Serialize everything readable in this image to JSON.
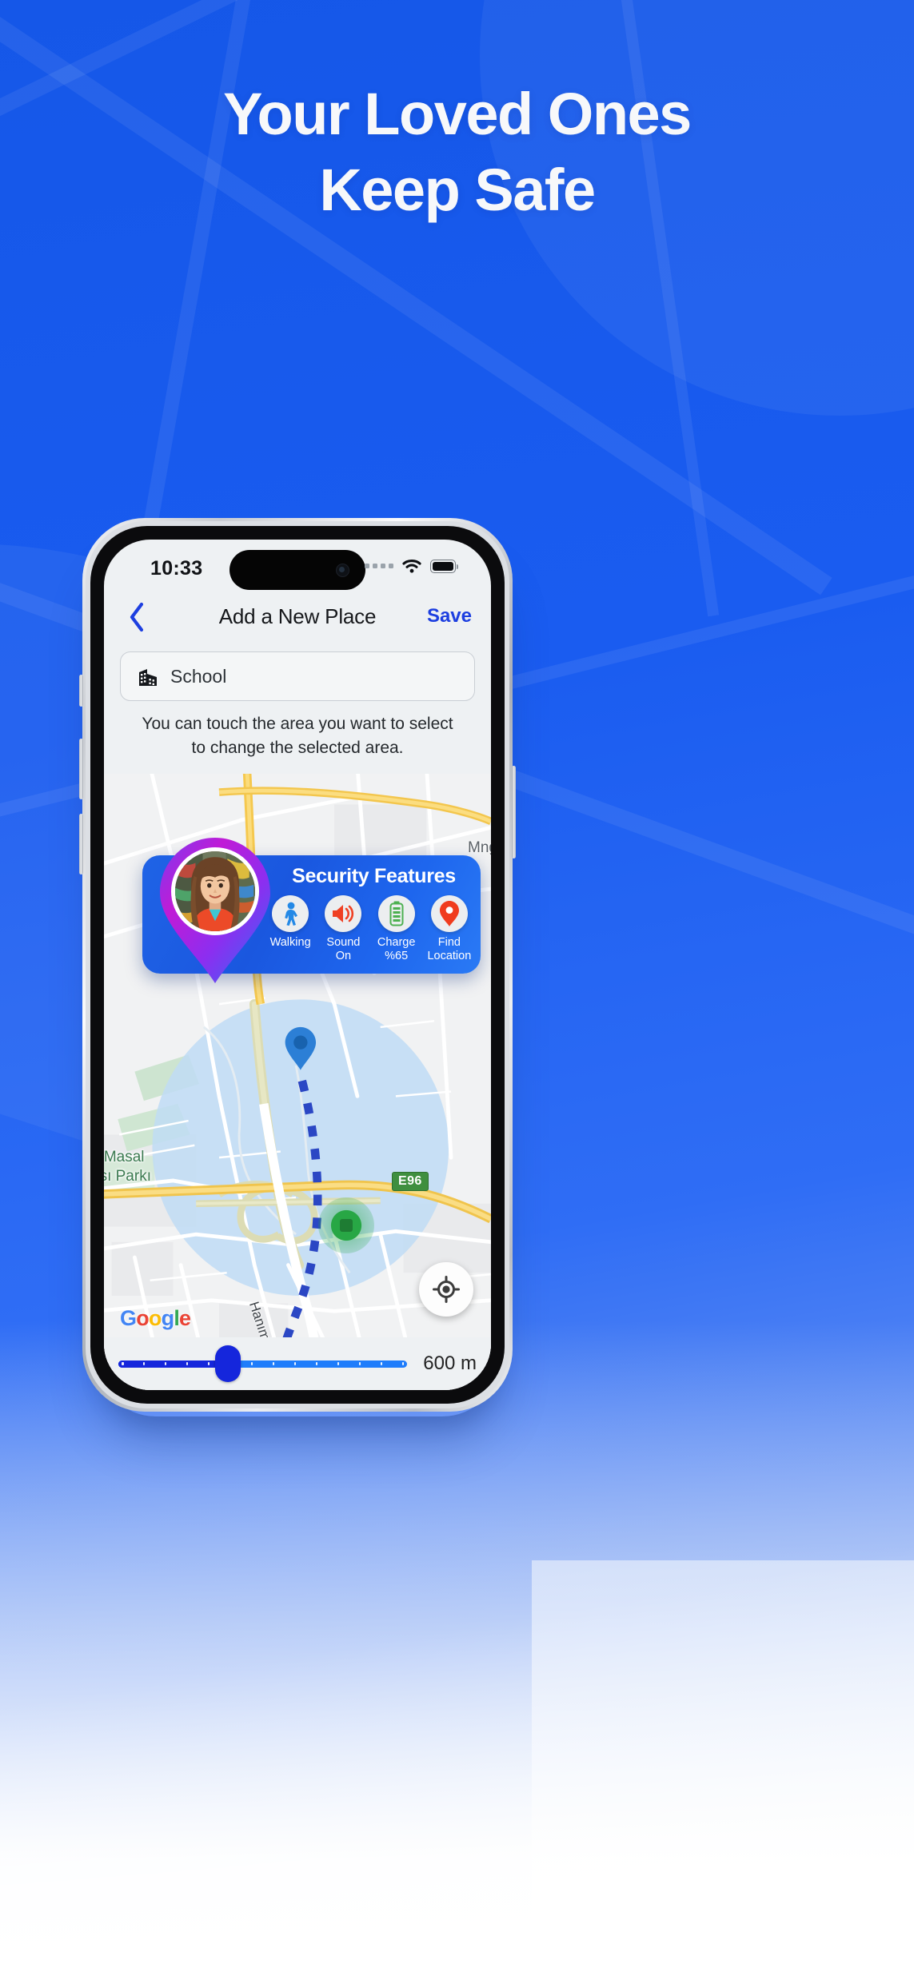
{
  "promo": {
    "headline_line1": "Your Loved Ones",
    "headline_line2": "Keep Safe",
    "brand_blue": "#1557e8"
  },
  "phone": {
    "status_bar": {
      "time": "10:33",
      "cellular_icon": "cellular-dots-icon",
      "wifi_icon": "wifi-icon",
      "battery_icon": "battery-icon"
    },
    "nav_bar": {
      "back_icon": "chevron-left-icon",
      "title": "Add a New Place",
      "save_label": "Save",
      "save_color": "#1d3fe0"
    },
    "name_field": {
      "icon": "building-icon",
      "value": "School",
      "placeholder": "School"
    },
    "hint": "You can touch the area you want to select to change the selected area.",
    "security_card": {
      "title": "Security Features",
      "avatar_icon": "avatar-photo",
      "items": [
        {
          "icon": "walking-person-icon",
          "label": "Walking",
          "color": "#2489e6"
        },
        {
          "icon": "speaker-sound-icon",
          "label": "Sound\nOn",
          "label_line1": "Sound",
          "label_line2": "On",
          "color": "#ef4023"
        },
        {
          "icon": "battery-charge-icon",
          "label": "Charge\n%65",
          "label_line1": "Charge",
          "label_line2": "%65",
          "color": "#4cb050"
        },
        {
          "icon": "map-pin-icon",
          "label": "Find\nLocation",
          "label_line1": "Find",
          "label_line2": "Location",
          "color": "#f03c1e"
        }
      ]
    },
    "map": {
      "attribution": "Google",
      "attribution_letters": [
        "G",
        "o",
        "o",
        "g",
        "l",
        "e"
      ],
      "labels": [
        {
          "name": "park-label",
          "text_line1": "n Masal",
          "text_line2": "ası Parkı",
          "color": "#3b7a50"
        },
        {
          "name": "area-label-mng",
          "text": "Mng",
          "color": "#5b6167"
        },
        {
          "name": "street-label",
          "text": "Hanım Blv.",
          "color": "#3f4449"
        }
      ],
      "highway_shield": "E96",
      "markers": [
        {
          "name": "place-pin",
          "type": "blue-pin"
        },
        {
          "name": "child-marker",
          "type": "green-dot"
        },
        {
          "name": "current-location",
          "type": "cyan-pulse"
        }
      ],
      "my_location_icon": "my-location-crosshair-icon",
      "geofence_color": "#bfdcf5"
    },
    "radius_slider": {
      "value_label": "600 m",
      "fill_percent": 38,
      "track_color": "#1f7dfb",
      "fill_color": "#1526dc"
    }
  }
}
